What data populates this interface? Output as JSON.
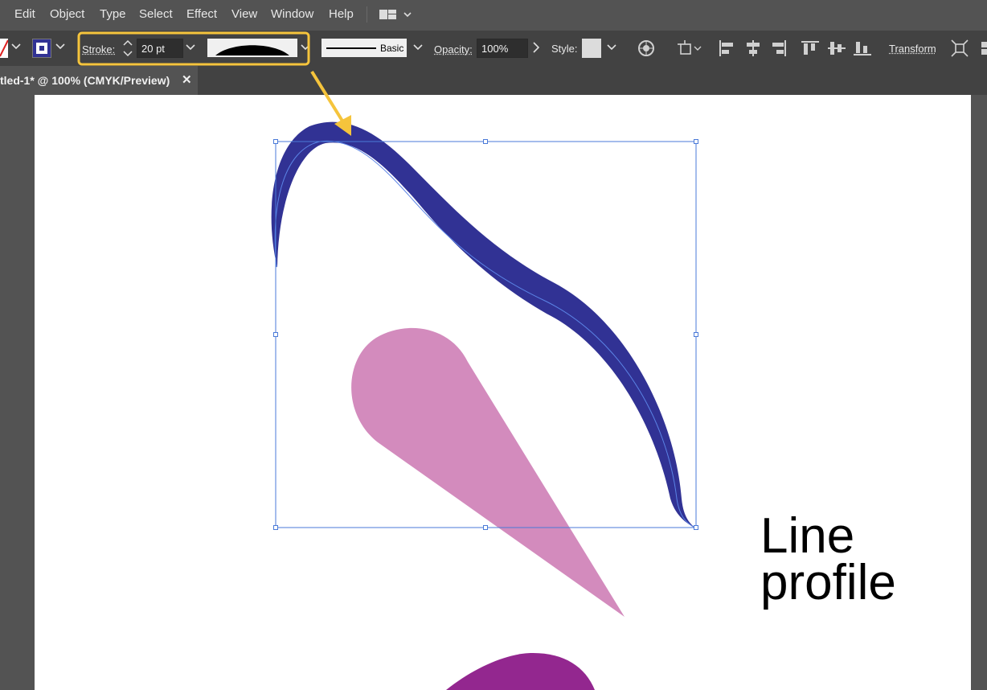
{
  "menu": {
    "items": [
      "Edit",
      "Object",
      "Type",
      "Select",
      "Effect",
      "View",
      "Window",
      "Help"
    ]
  },
  "control_bar": {
    "stroke_label": "Stroke:",
    "stroke_weight": "20 pt",
    "brush_label": "Basic",
    "opacity_label": "Opacity:",
    "opacity_value": "100%",
    "style_label": "Style:",
    "transform_label": "Transform"
  },
  "document_tab": {
    "title": "tled-1* @ 100% (CMYK/Preview)",
    "close": "✕"
  },
  "canvas_text": {
    "line1": "Line",
    "line2": "profile"
  },
  "colors": {
    "stroke_blue": "#313294",
    "pink_shape": "#d38bbd",
    "purple_shape": "#93278f",
    "highlight": "#f5c43c",
    "selection": "#4a7ad8"
  }
}
